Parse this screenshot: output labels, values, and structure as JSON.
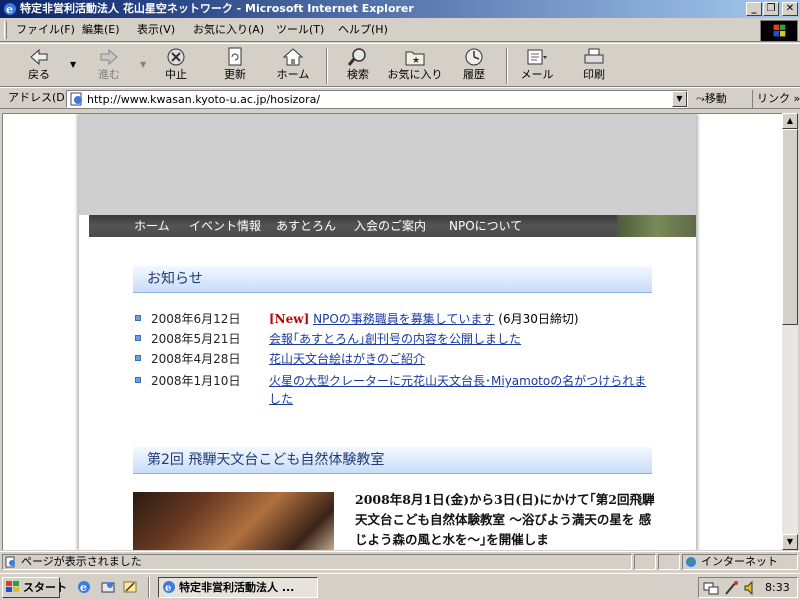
{
  "window": {
    "title": "特定非営利活動法人 花山星空ネットワーク - Microsoft Internet Explorer",
    "minimize": "_",
    "maximize": "❐",
    "close": "✕"
  },
  "menu": [
    "ファイル(F)",
    "編集(E)",
    "表示(V)",
    "お気に入り(A)",
    "ツール(T)",
    "ヘルプ(H)"
  ],
  "toolbar": {
    "back": "戻る",
    "forward": "進む",
    "stop": "中止",
    "refresh": "更新",
    "home": "ホーム",
    "search": "検索",
    "favorites": "お気に入り",
    "history": "履歴",
    "mail": "メール",
    "print": "印刷"
  },
  "address": {
    "label": "アドレス(D)",
    "url": "http://www.kwasan.kyoto-u.ac.jp/hosizora/",
    "go": "移動",
    "links": "リンク »"
  },
  "page": {
    "nav": [
      "ホーム",
      "イベント情報",
      "あすとろん",
      "入会のご案内",
      "NPOについて"
    ],
    "news_heading": "お知らせ",
    "news": [
      {
        "date": "2008年6月12日",
        "tag": "[New]",
        "link": "NPOの事務職員を募集しています",
        "extra": "(6月30日締切)"
      },
      {
        "date": "2008年5月21日",
        "tag": "",
        "link": "会報｢あすとろん｣創刊号の内容を公開しました",
        "extra": ""
      },
      {
        "date": "2008年4月28日",
        "tag": "",
        "link": "花山天文台絵はがきのご紹介",
        "extra": ""
      },
      {
        "date": "2008年1月10日",
        "tag": "",
        "link": "火星の大型クレーターに元花山天文台長･Miyamotoの名がつけられました",
        "extra": ""
      }
    ],
    "event_heading": "第2回 飛騨天文台こども自然体験教室",
    "event_text": "2008年8月1日(金)から3日(日)にかけて｢第2回飛騨天文台こども自然体験教室 ～浴びよう満天の星を 感じよう森の風と水を～｣を開催しま"
  },
  "status": {
    "message": "ページが表示されました",
    "zone": "インターネット"
  },
  "taskbar": {
    "start": "スタート",
    "task": "特定非営利活動法人 ...",
    "clock": "8:33"
  }
}
